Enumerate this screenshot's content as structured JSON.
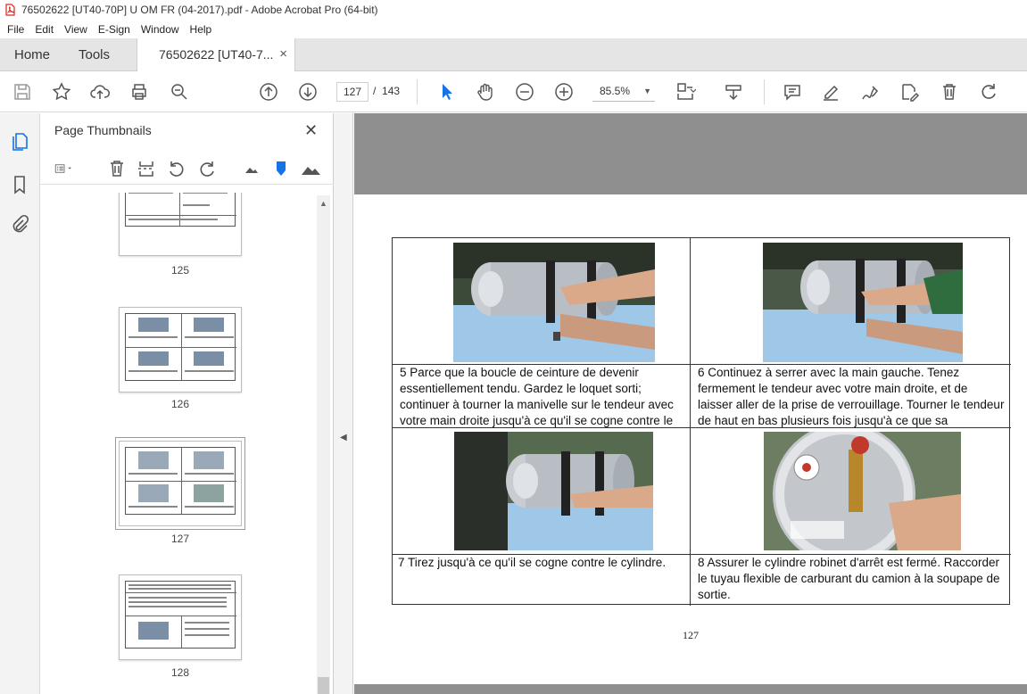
{
  "window": {
    "title": "76502622 [UT40-70P] U OM FR (04-2017).pdf - Adobe Acrobat Pro (64-bit)"
  },
  "menu": [
    "File",
    "Edit",
    "View",
    "E-Sign",
    "Window",
    "Help"
  ],
  "tabs": {
    "home": "Home",
    "tools": "Tools",
    "document": "76502622 [UT40-7...",
    "close": "×"
  },
  "toolbar": {
    "current_page": "127",
    "page_separator": "/",
    "total_pages": "143",
    "zoom": "85.5%",
    "icons": [
      "save-icon",
      "bookmark-star-icon",
      "upload-icon",
      "print-icon",
      "search-zoom-icon",
      "prev-page-icon",
      "next-page-icon",
      "select-cursor-icon",
      "hand-icon",
      "zoom-out-icon",
      "zoom-in-icon",
      "fit-page-icon",
      "scroll-mode-icon",
      "comment-icon",
      "highlight-icon",
      "sign-icon",
      "edit-icon",
      "delete-icon",
      "rotate-icon"
    ]
  },
  "panel": {
    "title": "Page Thumbnails",
    "close": "✕",
    "thumbnails": [
      {
        "label": "125"
      },
      {
        "label": "126"
      },
      {
        "label": "127",
        "selected": true
      },
      {
        "label": "128"
      }
    ]
  },
  "document": {
    "page_number": "127",
    "cells": [
      {
        "text": "5 Parce que la boucle de ceinture de devenir essentiellement tendu. Gardez le loquet sorti; continuer à tourner la manivelle sur le tendeur avec votre main droite jusqu'à ce qu'il se cogne contre le"
      },
      {
        "text": "6 Continuez à serrer avec la main gauche. Tenez fermement le tendeur avec votre main droite, et de laisser aller de la prise de verrouillage. Tourner le tendeur de haut en bas plusieurs fois jusqu'à ce que sa"
      },
      {
        "text": "7 Tirez jusqu'à ce qu'il se cogne contre le cylindre."
      },
      {
        "text": "8 Assurer le cylindre robinet d'arrêt est fermé. Raccorder le tuyau flexible de carburant du camion à la soupape de sortie."
      }
    ]
  },
  "colors": {
    "accent": "#1473e6",
    "doc_background": "#8f8f8f"
  }
}
